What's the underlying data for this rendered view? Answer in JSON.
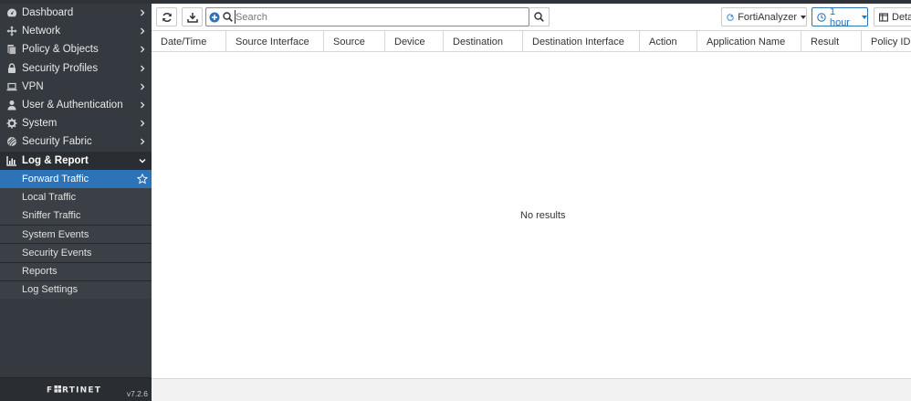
{
  "sidebar": {
    "items": [
      {
        "label": "Dashboard",
        "icon": "dashboard-icon"
      },
      {
        "label": "Network",
        "icon": "network-icon"
      },
      {
        "label": "Policy & Objects",
        "icon": "policy-icon"
      },
      {
        "label": "Security Profiles",
        "icon": "lock-icon"
      },
      {
        "label": "VPN",
        "icon": "laptop-icon"
      },
      {
        "label": "User & Authentication",
        "icon": "user-icon"
      },
      {
        "label": "System",
        "icon": "gear-icon"
      },
      {
        "label": "Security Fabric",
        "icon": "fabric-icon"
      },
      {
        "label": "Log & Report",
        "icon": "chart-icon"
      }
    ],
    "sub_items": [
      {
        "label": "Forward Traffic"
      },
      {
        "label": "Local Traffic"
      },
      {
        "label": "Sniffer Traffic"
      },
      {
        "label": "System Events"
      },
      {
        "label": "Security Events"
      },
      {
        "label": "Reports"
      },
      {
        "label": "Log Settings"
      }
    ],
    "footer": {
      "logo_text": "FORTINET",
      "version": "v7.2.6"
    }
  },
  "toolbar": {
    "search_placeholder": "Search",
    "source_label": "FortiAnalyzer",
    "time_label": "1 hour",
    "details_label": "Deta"
  },
  "table": {
    "columns": [
      "Date/Time",
      "Source Interface",
      "Source",
      "Device",
      "Destination",
      "Destination Interface",
      "Action",
      "Application Name",
      "Result",
      "Policy ID"
    ],
    "empty_message": "No results"
  },
  "colors": {
    "sidebar_bg": "#353a40",
    "active": "#2d73b7"
  }
}
